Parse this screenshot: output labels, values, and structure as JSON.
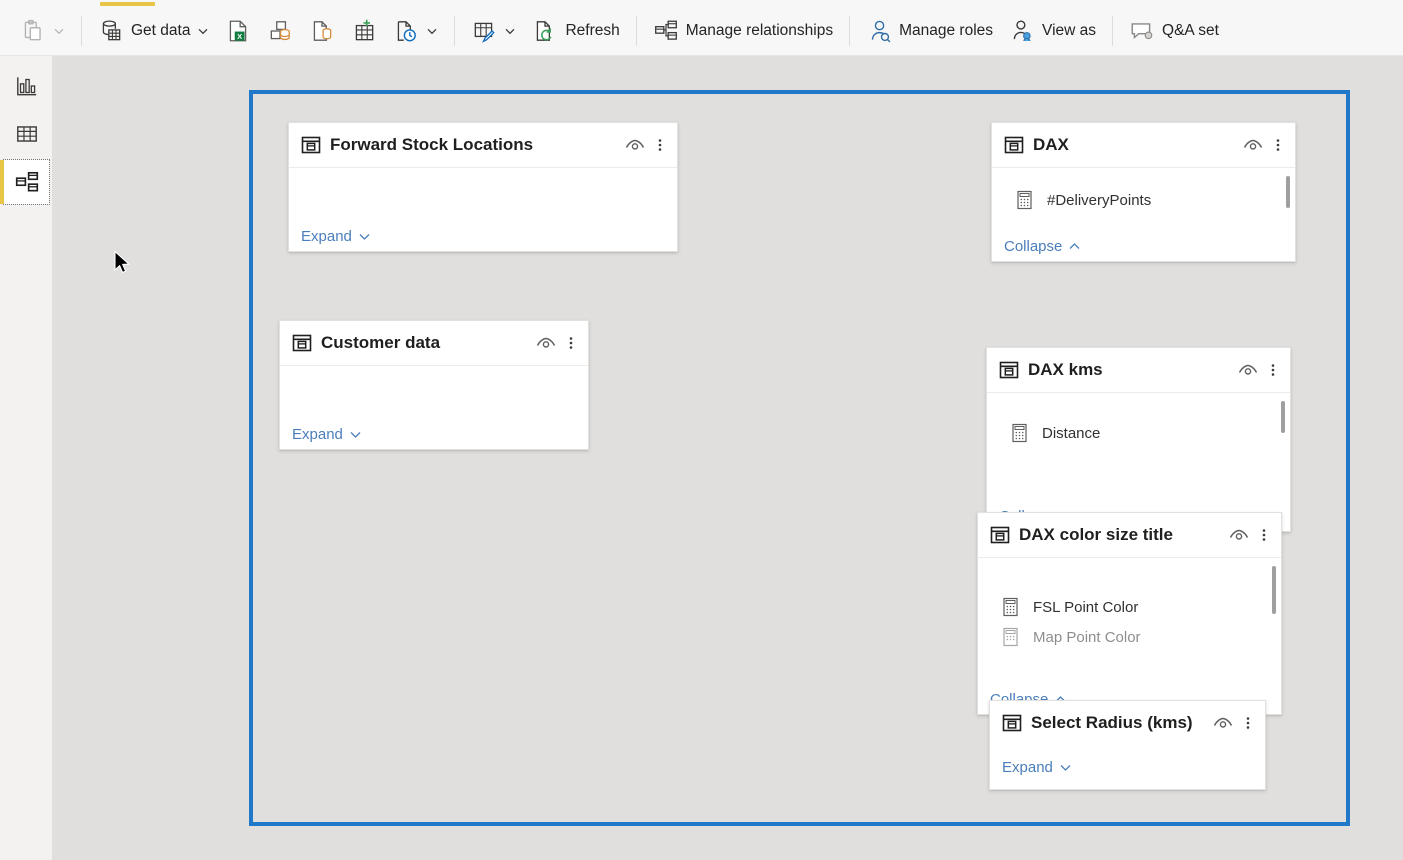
{
  "ribbon": {
    "active_tab_indicator": true,
    "accent_color": "#e8c547",
    "items": [
      {
        "name": "paste",
        "label": "",
        "icon": "clipboard-icon",
        "has_chevron": true,
        "disabled": true
      },
      {
        "name": "separator",
        "label": "",
        "icon": "separator",
        "has_chevron": false,
        "disabled": false
      },
      {
        "name": "get-data",
        "label": "Get data",
        "icon": "database-icon",
        "has_chevron": true,
        "disabled": false
      },
      {
        "name": "excel-workbook",
        "label": "",
        "icon": "excel-icon",
        "has_chevron": false,
        "disabled": false
      },
      {
        "name": "sql-server",
        "label": "",
        "icon": "sql-server-icon",
        "has_chevron": false,
        "disabled": false
      },
      {
        "name": "dataverse",
        "label": "",
        "icon": "dataverse-icon",
        "has_chevron": false,
        "disabled": false
      },
      {
        "name": "enter-data",
        "label": "",
        "icon": "enter-data-icon",
        "has_chevron": false,
        "disabled": false
      },
      {
        "name": "recent-sources",
        "label": "",
        "icon": "recent-sources-icon",
        "has_chevron": true,
        "disabled": false
      },
      {
        "name": "separator",
        "label": "",
        "icon": "separator",
        "has_chevron": false,
        "disabled": false
      },
      {
        "name": "transform-data",
        "label": "",
        "icon": "transform-data-icon",
        "has_chevron": true,
        "disabled": false
      },
      {
        "name": "refresh",
        "label": "Refresh",
        "icon": "refresh-icon",
        "has_chevron": false,
        "disabled": false
      },
      {
        "name": "separator",
        "label": "",
        "icon": "separator",
        "has_chevron": false,
        "disabled": false
      },
      {
        "name": "manage-relationships",
        "label": "Manage relationships",
        "icon": "relationships-icon",
        "has_chevron": false,
        "disabled": false
      },
      {
        "name": "separator",
        "label": "",
        "icon": "separator",
        "has_chevron": false,
        "disabled": false
      },
      {
        "name": "manage-roles",
        "label": "Manage roles",
        "icon": "manage-roles-icon",
        "has_chevron": false,
        "disabled": false
      },
      {
        "name": "view-as",
        "label": "View as",
        "icon": "view-as-icon",
        "has_chevron": false,
        "disabled": false
      },
      {
        "name": "separator",
        "label": "",
        "icon": "separator",
        "has_chevron": false,
        "disabled": false
      },
      {
        "name": "qna-setup",
        "label": "Q&A set",
        "icon": "qna-icon",
        "has_chevron": false,
        "disabled": false
      }
    ]
  },
  "rail": {
    "items": [
      {
        "name": "report-view",
        "icon": "bar-chart-icon",
        "selected": false
      },
      {
        "name": "data-view",
        "icon": "table-grid-icon",
        "selected": false
      },
      {
        "name": "model-view",
        "icon": "model-relationship-icon",
        "selected": true
      }
    ]
  },
  "canvas": {
    "background_color": "#e0dfdd",
    "selection_border_color": "#1f78c8",
    "table_icon": "table-card-icon",
    "hide_icon": "eye-hide-icon",
    "menu_icon": "more-options-icon",
    "measure_icon": "measure-calculator-icon",
    "expand_label": "Expand",
    "collapse_label": "Collapse",
    "tables": [
      {
        "name": "forward-stock-locations",
        "title": "Forward Stock Locations",
        "state": "collapsed",
        "footer_label": "Expand",
        "fields": [],
        "has_scrollbar": false
      },
      {
        "name": "customer-data",
        "title": "Customer data",
        "state": "collapsed",
        "footer_label": "Expand",
        "fields": [],
        "has_scrollbar": false
      },
      {
        "name": "dax",
        "title": "DAX",
        "state": "expanded",
        "footer_label": "Collapse",
        "fields": [
          {
            "name": "delivery-points-measure",
            "label": "#DeliveryPoints",
            "icon": "measure-calculator-icon"
          }
        ],
        "has_scrollbar": true
      },
      {
        "name": "dax-kms",
        "title": "DAX kms",
        "state": "expanded",
        "footer_label": "Collapse",
        "fields": [
          {
            "name": "distance-measure",
            "label": "Distance",
            "icon": "measure-calculator-icon"
          }
        ],
        "has_scrollbar": true
      },
      {
        "name": "dax-color-size-title",
        "title": "DAX color size title",
        "state": "expanded",
        "footer_label": "Collapse",
        "fields": [
          {
            "name": "fsl-point-color-measure",
            "label": "FSL Point Color",
            "icon": "measure-calculator-icon"
          },
          {
            "name": "map-point-color-measure",
            "label": "Map Point Color",
            "icon": "measure-calculator-icon"
          }
        ],
        "has_scrollbar": true
      },
      {
        "name": "select-radius-kms",
        "title": "Select Radius (kms)",
        "state": "collapsed",
        "footer_label": "Expand",
        "fields": [],
        "has_scrollbar": false
      }
    ]
  }
}
